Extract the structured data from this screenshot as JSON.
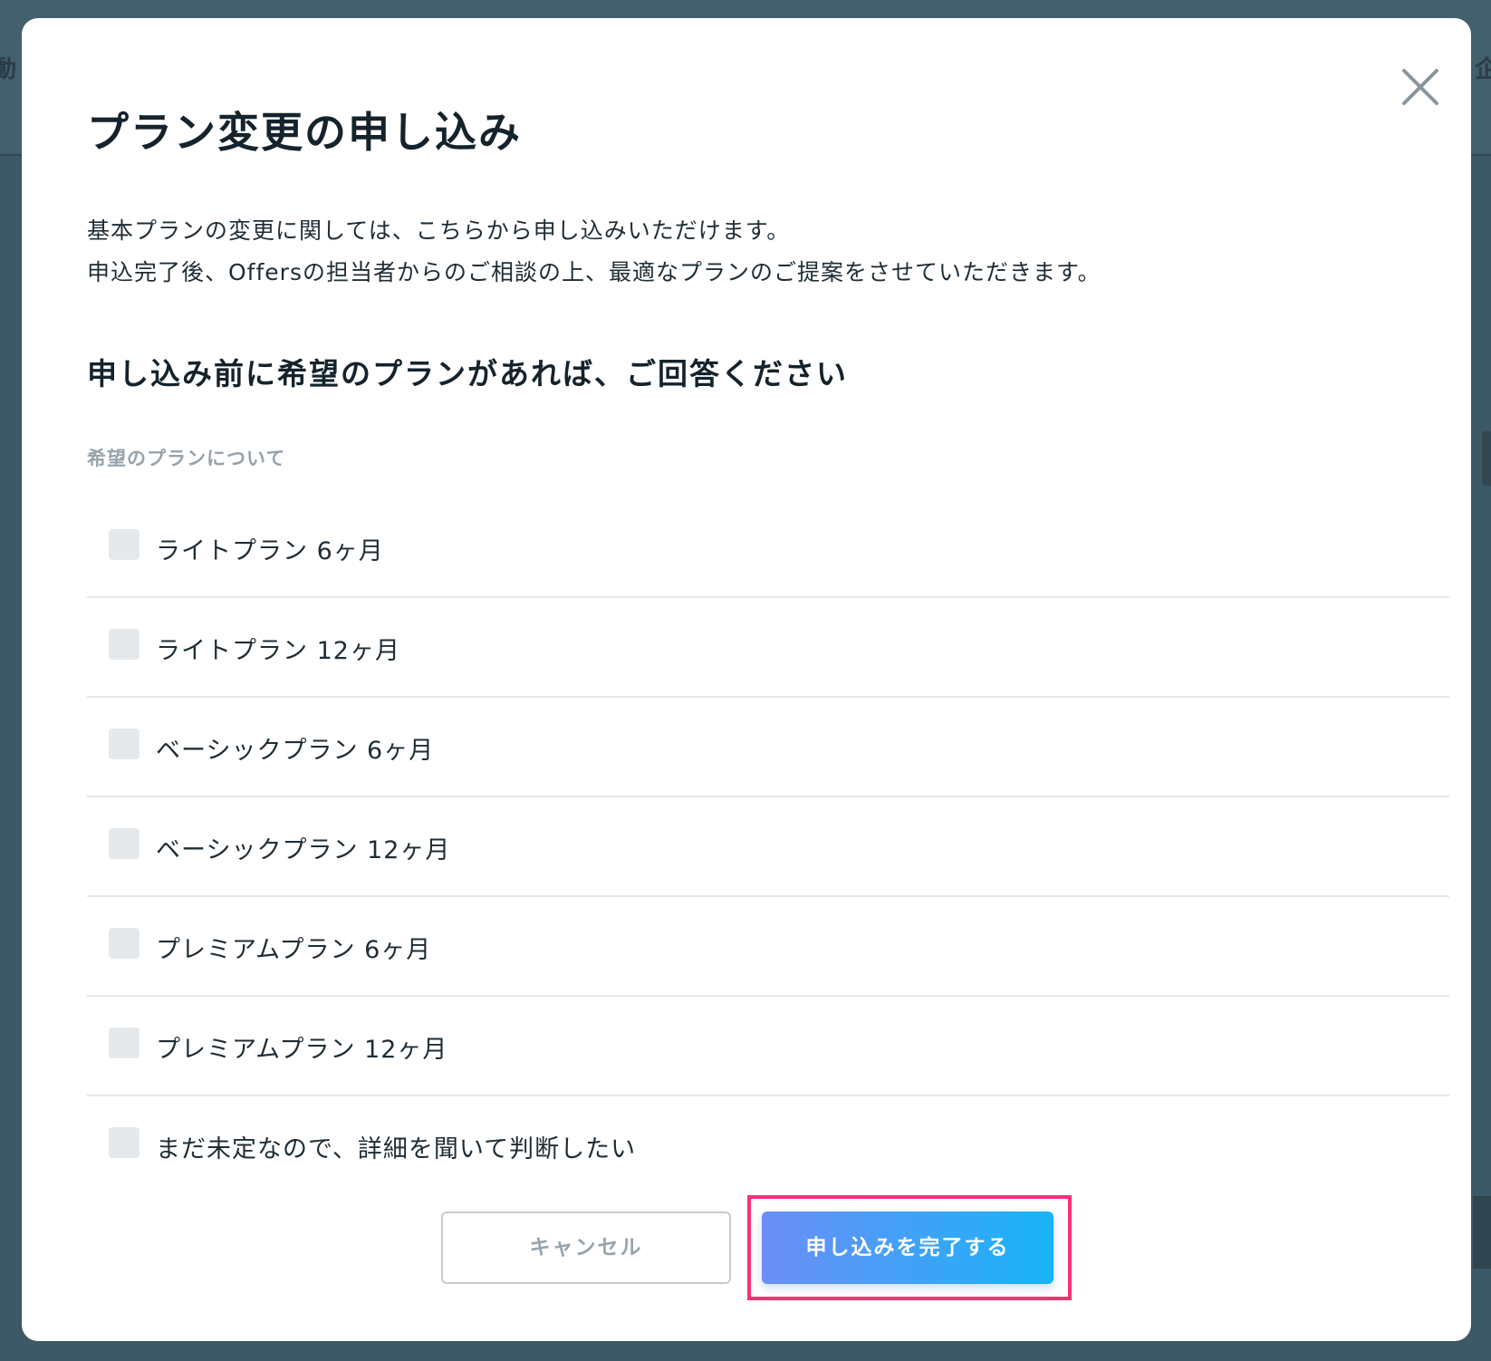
{
  "background": {
    "glyph_left": "動",
    "glyph_right": "企"
  },
  "modal": {
    "close_icon": "close-icon",
    "title": "プラン変更の申し込み",
    "description_lines": [
      "基本プランの変更に関しては、こちらから申し込みいただけます。",
      "申込完了後、Offersの担当者からのご相談の上、最適なプランのご提案をさせていただきます。"
    ],
    "section_title": "申し込み前に希望のプランがあれば、ご回答ください",
    "field_label": "希望のプランについて",
    "options": [
      {
        "label": "ライトプラン 6ヶ月",
        "checked": false
      },
      {
        "label": "ライトプラン 12ヶ月",
        "checked": false
      },
      {
        "label": "ベーシックプラン 6ヶ月",
        "checked": false
      },
      {
        "label": "ベーシックプラン 12ヶ月",
        "checked": false
      },
      {
        "label": "プレミアムプラン 6ヶ月",
        "checked": false
      },
      {
        "label": "プレミアムプラン 12ヶ月",
        "checked": false
      },
      {
        "label": "まだ未定なので、詳細を聞いて判断したい",
        "checked": false
      }
    ],
    "cancel_label": "キャンセル",
    "submit_label": "申し込みを完了する"
  },
  "colors": {
    "overlay": "#3d5866",
    "title_text": "#14232c",
    "submit_gradient_start": "#6c8ef6",
    "submit_gradient_end": "#18b4f8",
    "highlight": "#ff2f79",
    "checkbox": "#e5e9ec"
  }
}
